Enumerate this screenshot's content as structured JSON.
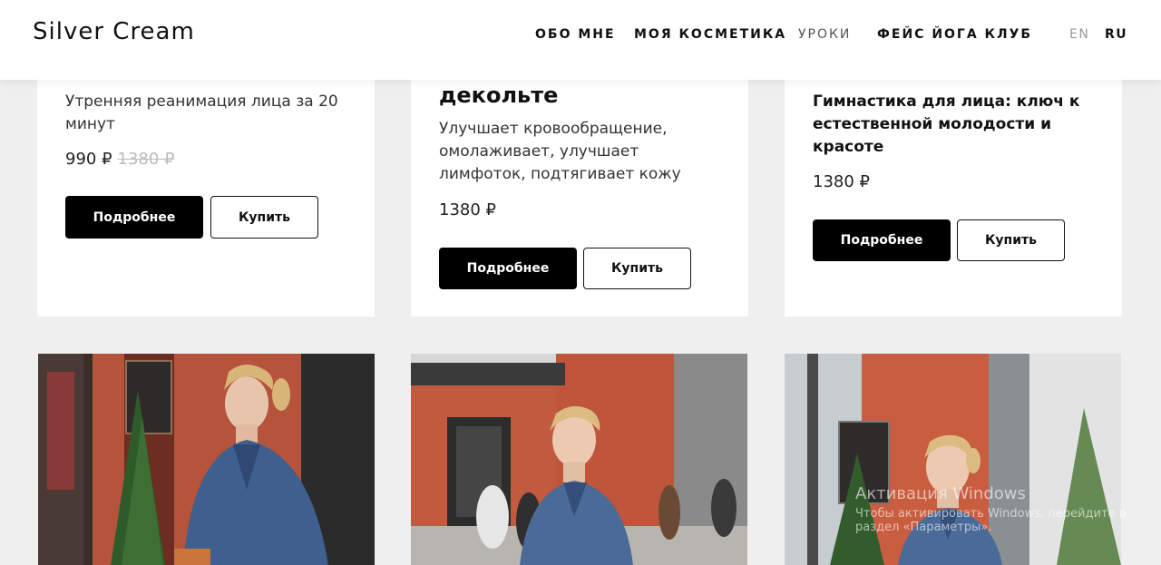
{
  "header": {
    "logo": "Silver Cream",
    "nav": [
      {
        "label": "ОБО МНЕ"
      },
      {
        "label": "МОЯ КОСМЕТИКА"
      },
      {
        "label": "УРОКИ"
      },
      {
        "label": "ФЕЙС ЙОГА КЛУБ"
      }
    ],
    "lang_en": "EN",
    "lang_ru": "RU"
  },
  "cards": [
    {
      "description": "Утренняя реанимация лица за 20 минут",
      "price": "990 ₽",
      "old_price": "1380 ₽",
      "details_label": "Подробнее",
      "buy_label": "Купить"
    },
    {
      "title": "декольте",
      "description": "Улучшает кровообращение, омолаживает, улучшает лимфоток, подтягивает кожу",
      "price": "1380 ₽",
      "details_label": "Подробнее",
      "buy_label": "Купить"
    },
    {
      "title": "Гимнастика для лица: ключ к естественной молодости и красоте",
      "price": "1380 ₽",
      "details_label": "Подробнее",
      "buy_label": "Купить"
    }
  ],
  "watermark": {
    "line1": "Активация Windows",
    "line2": "Чтобы активировать Windows, перейдите в раздел «Параметры»."
  },
  "colors": {
    "accent": "#000000",
    "page_bg": "#efefef",
    "brick": "#c65a3c"
  }
}
